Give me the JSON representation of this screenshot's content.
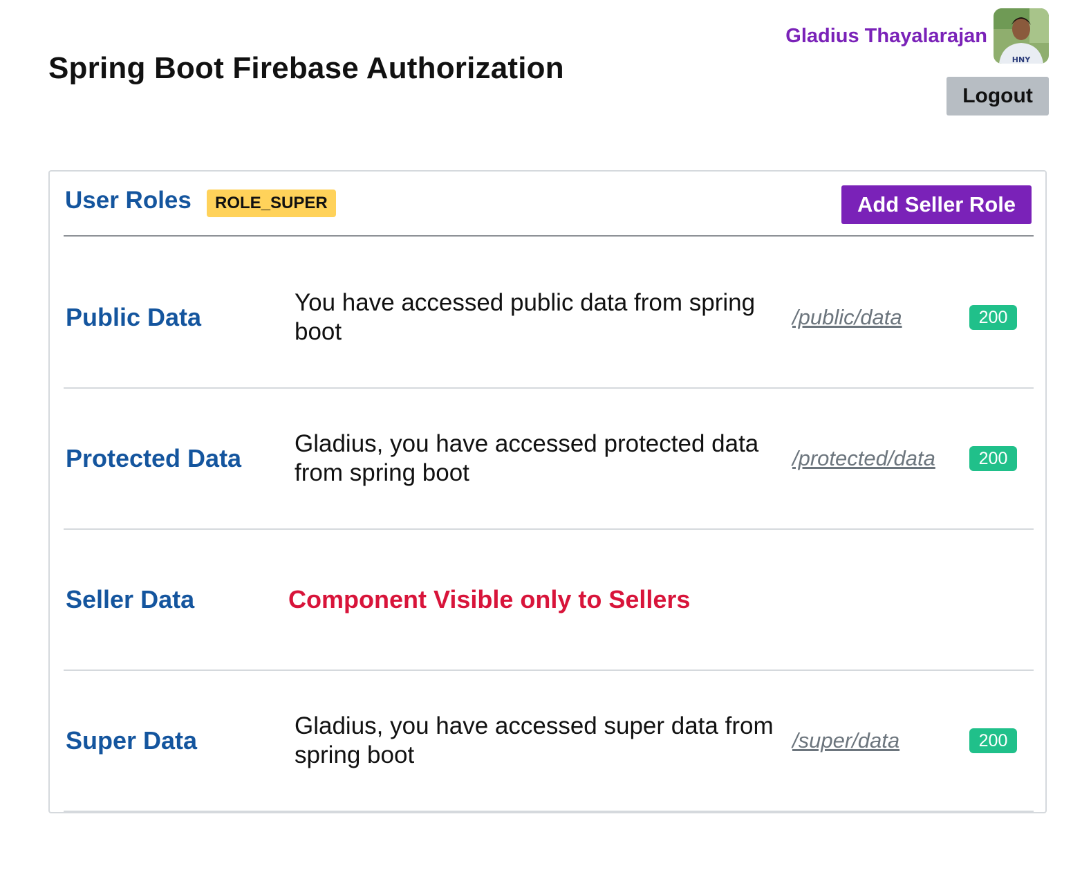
{
  "header": {
    "title": "Spring Boot Firebase Authorization",
    "user_name": "Gladius Thayalarajan",
    "avatar_shirt_text": "HNY",
    "logout_label": "Logout"
  },
  "panel": {
    "roles_title": "User Roles",
    "role_badge": "ROLE_SUPER",
    "add_seller_label": "Add Seller Role"
  },
  "rows": [
    {
      "label": "Public Data",
      "message": "You have accessed public data from spring boot",
      "endpoint": "/public/data",
      "status": "200"
    },
    {
      "label": "Protected Data",
      "message": "Gladius, you have accessed protected data from spring boot",
      "endpoint": "/protected/data",
      "status": "200"
    },
    {
      "label": "Seller Data",
      "warning": "Component Visible only to Sellers"
    },
    {
      "label": "Super Data",
      "message": "Gladius, you have accessed super data from spring boot",
      "endpoint": "/super/data",
      "status": "200"
    }
  ],
  "colors": {
    "brand_purple": "#7a22b8",
    "heading_blue": "#14559e",
    "badge_yellow": "#ffd25a",
    "status_green": "#20c08a",
    "warning_red": "#d8143a",
    "logout_gray": "#b7bdc3"
  }
}
